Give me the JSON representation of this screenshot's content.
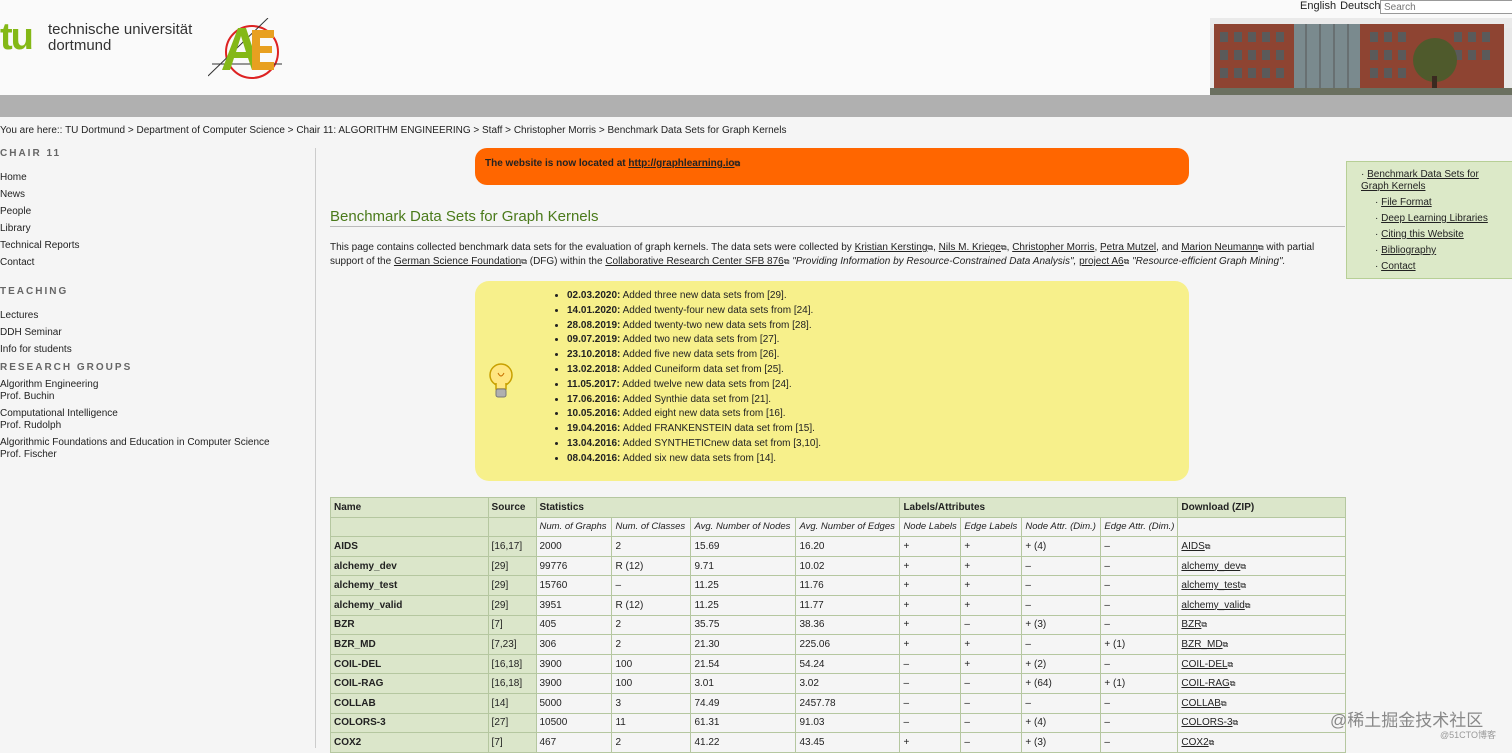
{
  "header": {
    "logo_tu": "tu",
    "logo_uni_line1": "technische universität",
    "logo_uni_line2": "dortmund",
    "lang_english": "English",
    "lang_deutsch": "Deutsch",
    "search_placeholder": "Search"
  },
  "breadcrumb": {
    "prefix": "You are here::",
    "items": [
      "TU Dortmund",
      "Department of Computer Science",
      "Chair 11: ALGORITHM ENGINEERING",
      "Staff",
      "Christopher Morris",
      "Benchmark Data Sets for Graph Kernels"
    ]
  },
  "leftnav": {
    "chair_heading": "CHAIR 11",
    "chair_items": [
      "Home",
      "News",
      "People",
      "Library",
      "Technical Reports",
      "Contact"
    ],
    "teaching_heading": "TEACHING",
    "teaching_items": [
      "Lectures",
      "DDH Seminar",
      "Info for students"
    ],
    "research_heading": "RESEARCH GROUPS",
    "research_items": [
      {
        "line1": "Algorithm Engineering",
        "line2": "Prof. Buchin"
      },
      {
        "line1": "Computational Intelligence",
        "line2": "Prof. Rudolph"
      },
      {
        "line1": "Algorithmic Foundations and Education in Computer Science",
        "line2": "Prof. Fischer"
      }
    ]
  },
  "notice": {
    "text": "The website is now located at",
    "link": "http://graphlearning.io"
  },
  "page_title": "Benchmark Data Sets for Graph Kernels",
  "intro": {
    "t1": "This page contains collected benchmark data sets for the evaluation of graph kernels. The data sets were collected by",
    "a1": "Kristian Kersting",
    "a2": "Nils M. Kriege",
    "a3": "Christopher Morris",
    "a4": "Petra Mutzel",
    "t_and": ", and",
    "a5": "Marion Neumann",
    "t2": "with partial support of the",
    "a6": "German Science Foundation",
    "t3": "(DFG) within the",
    "a7": "Collaborative Research Center SFB 876",
    "t4": "\"Providing Information by Resource-Constrained Data Analysis\",",
    "a8": "project A6",
    "t5": "\"Resource-efficient Graph Mining\"."
  },
  "news": [
    {
      "date": "02.03.2020:",
      "text": "Added three new data sets from [29]."
    },
    {
      "date": "14.01.2020:",
      "text": "Added twenty-four new data sets from [24]."
    },
    {
      "date": "28.08.2019:",
      "text": "Added twenty-two new data sets from [28]."
    },
    {
      "date": "09.07.2019:",
      "text": "Added two new data sets from [27]."
    },
    {
      "date": "23.10.2018:",
      "text": "Added five new data sets from [26]."
    },
    {
      "date": "13.02.2018:",
      "text": "Added Cuneiform data set from [25]."
    },
    {
      "date": "11.05.2017:",
      "text": "Added twelve new data sets from [24]."
    },
    {
      "date": "17.06.2016:",
      "text": "Added Synthie data set from [21]."
    },
    {
      "date": "10.05.2016:",
      "text": "Added eight new data sets from [16]."
    },
    {
      "date": "19.04.2016:",
      "text": "Added FRANKENSTEIN data set from [15]."
    },
    {
      "date": "13.04.2016:",
      "text": "Added SYNTHETICnew data set from [3,10]."
    },
    {
      "date": "08.04.2016:",
      "text": "Added six new data sets from [14]."
    }
  ],
  "rightbox": {
    "main": "Benchmark Data Sets for Graph Kernels",
    "items": [
      "File Format",
      "Deep Learning Libraries",
      "Citing this Website",
      "Bibliography",
      "Contact"
    ]
  },
  "table": {
    "h_name": "Name",
    "h_source": "Source",
    "h_statistics": "Statistics",
    "h_labels": "Labels/Attributes",
    "h_download": "Download (ZIP)",
    "sub": [
      "Num. of Graphs",
      "Num. of Classes",
      "Avg. Number of Nodes",
      "Avg. Number of Edges",
      "Node Labels",
      "Edge Labels",
      "Node Attr. (Dim.)",
      "Edge Attr. (Dim.)"
    ],
    "rows": [
      [
        "AIDS",
        "[16,17]",
        "2000",
        "2",
        "15.69",
        "16.20",
        "+",
        "+",
        "+ (4)",
        "–",
        "AIDS"
      ],
      [
        "alchemy_dev",
        "[29]",
        "99776",
        "R (12)",
        "9.71",
        "10.02",
        "+",
        "+",
        "–",
        "–",
        "alchemy_dev"
      ],
      [
        "alchemy_test",
        "[29]",
        "15760",
        "–",
        "11.25",
        "11.76",
        "+",
        "+",
        "–",
        "–",
        "alchemy_test"
      ],
      [
        "alchemy_valid",
        "[29]",
        "3951",
        "R (12)",
        "11.25",
        "11.77",
        "+",
        "+",
        "–",
        "–",
        "alchemy_valid"
      ],
      [
        "BZR",
        "[7]",
        "405",
        "2",
        "35.75",
        "38.36",
        "+",
        "–",
        "+ (3)",
        "–",
        "BZR"
      ],
      [
        "BZR_MD",
        "[7,23]",
        "306",
        "2",
        "21.30",
        "225.06",
        "+",
        "+",
        "–",
        "+ (1)",
        "BZR_MD"
      ],
      [
        "COIL-DEL",
        "[16,18]",
        "3900",
        "100",
        "21.54",
        "54.24",
        "–",
        "+",
        "+ (2)",
        "–",
        "COIL-DEL"
      ],
      [
        "COIL-RAG",
        "[16,18]",
        "3900",
        "100",
        "3.01",
        "3.02",
        "–",
        "–",
        "+ (64)",
        "+ (1)",
        "COIL-RAG"
      ],
      [
        "COLLAB",
        "[14]",
        "5000",
        "3",
        "74.49",
        "2457.78",
        "–",
        "–",
        "–",
        "–",
        "COLLAB"
      ],
      [
        "COLORS-3",
        "[27]",
        "10500",
        "11",
        "61.31",
        "91.03",
        "–",
        "–",
        "+ (4)",
        "–",
        "COLORS-3"
      ],
      [
        "COX2",
        "[7]",
        "467",
        "2",
        "41.22",
        "43.45",
        "+",
        "–",
        "+ (3)",
        "–",
        "COX2"
      ]
    ]
  },
  "watermark": {
    "brand": "@稀土掘金技术社区",
    "small": "@51CTO博客"
  },
  "colors": {
    "tu_green": "#84b817",
    "notice_orange": "#ff6600",
    "news_yellow": "#f7f08b",
    "table_header_green": "#dbe6ca",
    "title_green": "#4a7a1a"
  }
}
